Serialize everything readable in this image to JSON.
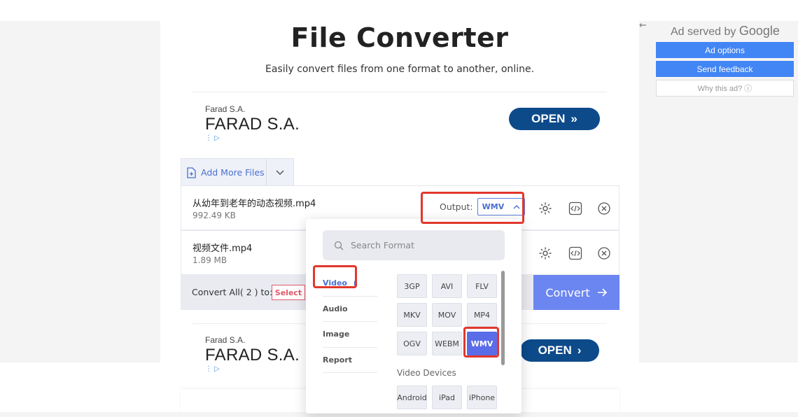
{
  "page": {
    "title": "File Converter",
    "subtitle": "Easily convert files from one format to another, online."
  },
  "ad_top": {
    "small_text": "Farad S.A.",
    "big_text": "FARAD S.A.",
    "open_label": "OPEN",
    "open_arrow": "»"
  },
  "ad_bottom": {
    "small_text": "Farad S.A.",
    "big_text": "FARAD S.A.",
    "open_label": "OPEN",
    "open_arrow": "›"
  },
  "converter": {
    "add_more_label": "Add More Files",
    "files": [
      {
        "name": "从幼年到老年的动态视频.mp4",
        "size": "992.49 KB",
        "output_label": "Output:",
        "output_value": "WMV"
      },
      {
        "name": "视频文件.mp4",
        "size": "1.89 MB"
      }
    ],
    "convert_all_label": "Convert All( 2 ) to:",
    "select_label": "Select",
    "convert_label": "Convert"
  },
  "format_dropdown": {
    "search_placeholder": "Search Format",
    "categories": [
      "Video",
      "Audio",
      "Image",
      "Report"
    ],
    "active_category": "Video",
    "formats": [
      "3GP",
      "AVI",
      "FLV",
      "MKV",
      "MOV",
      "MP4",
      "OGV",
      "WEBM",
      "WMV"
    ],
    "selected_format": "WMV",
    "devices_label": "Video Devices",
    "devices": [
      "Android",
      "iPad",
      "iPhone"
    ]
  },
  "google_ad": {
    "served_by": "Ad served by",
    "google": "Google",
    "ad_options": "Ad options",
    "send_feedback": "Send feedback",
    "why_this_ad": "Why this ad? ⓘ"
  },
  "colors": {
    "accent": "#5b6ce8",
    "convert_button": "#6b86f0",
    "highlight": "#e2372b",
    "google_blue": "#4285f4",
    "ad_button": "#0d4a8a"
  }
}
